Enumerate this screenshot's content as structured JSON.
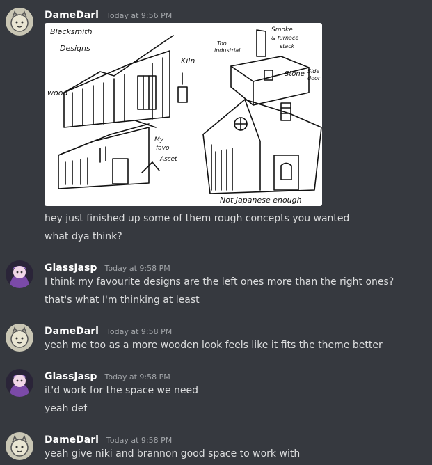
{
  "messages": [
    {
      "author": "DameDarl",
      "time": "Today at 9:56 PM",
      "avatar_icon": "sketch-cat-avatar",
      "sketch_text": {
        "title": "Blacksmith\nDesigns",
        "wood": "wood",
        "kiln": "Kiln",
        "too_industrial": "Too\nindustrial",
        "smoke": "Smoke\n& furnace\nstack",
        "stone": "Stone",
        "side_door": "Side\ndoor",
        "my_fav": "My\nfavo\nAsset",
        "not_japanese": "Not Japanese enough"
      },
      "lines": [
        "hey just finished up some of them rough concepts you wanted",
        "what dya think?"
      ]
    },
    {
      "author": "GlassJasp",
      "time": "Today at 9:58 PM",
      "avatar_icon": "purple-character-avatar",
      "lines": [
        "I think my favourite designs are the left ones more than the right ones?",
        "that's what I'm thinking at least"
      ]
    },
    {
      "author": "DameDarl",
      "time": "Today at 9:58 PM",
      "avatar_icon": "sketch-cat-avatar",
      "lines": [
        "yeah me too as a more wooden look feels like it fits the theme better"
      ]
    },
    {
      "author": "GlassJasp",
      "time": "Today at 9:58 PM",
      "avatar_icon": "purple-character-avatar",
      "lines": [
        "it'd work for the space we need",
        "yeah def"
      ]
    },
    {
      "author": "DameDarl",
      "time": "Today at 9:58 PM",
      "avatar_icon": "sketch-cat-avatar",
      "lines": [
        "yeah give niki and brannon good space to work with"
      ]
    }
  ],
  "colors": {
    "background": "#36393f",
    "author": "#ffffff",
    "timestamp": "#a3a6aa",
    "text": "#dcddde"
  }
}
